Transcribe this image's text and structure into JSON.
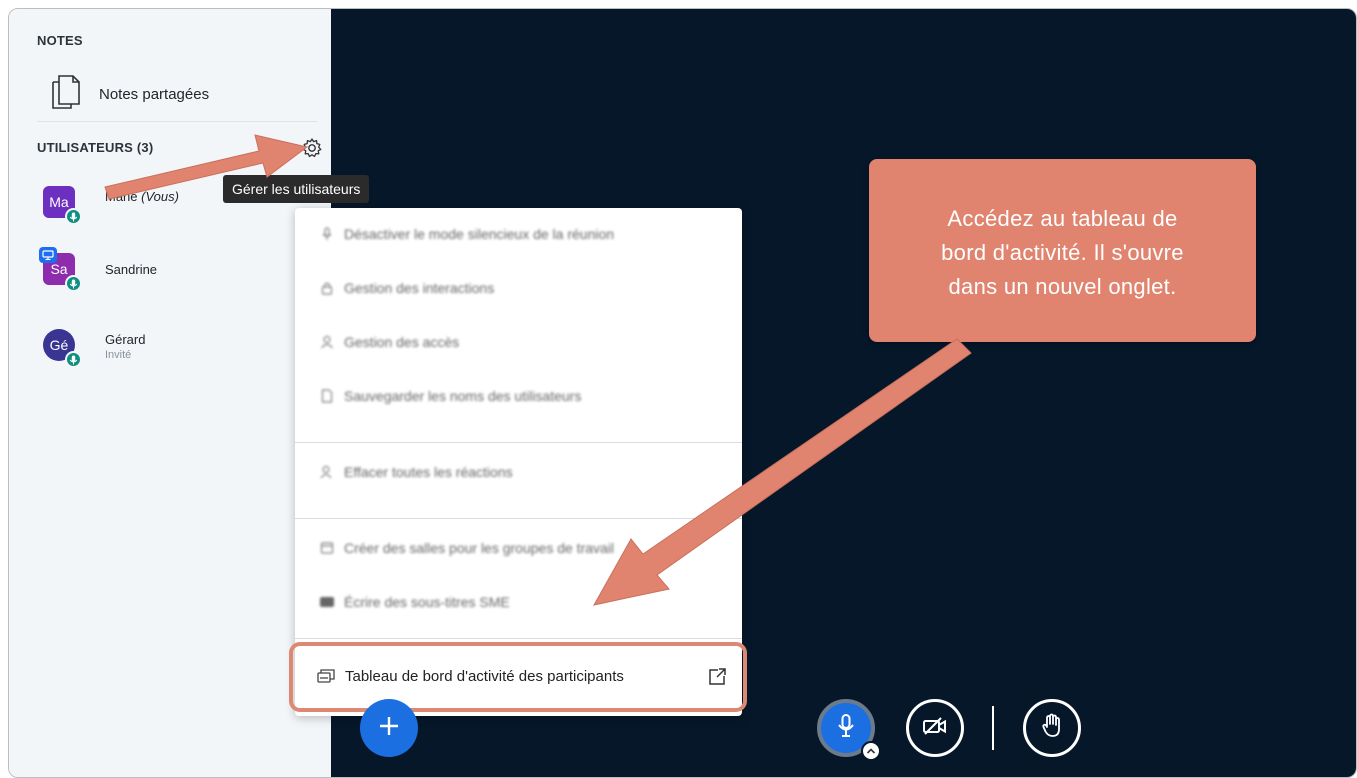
{
  "sidebar": {
    "notes_title": "NOTES",
    "notes_item_label": "Notes partagées",
    "users_title": "UTILISATEURS (3)",
    "users": [
      {
        "initials": "Ma",
        "name": "Marie",
        "suffix": "(Vous)",
        "role": "",
        "color": "#6c2fbf",
        "shape": "square"
      },
      {
        "initials": "Sa",
        "name": "Sandrine",
        "suffix": "",
        "role": "",
        "color": "#8e2cae",
        "shape": "square"
      },
      {
        "initials": "Gé",
        "name": "Gérard",
        "suffix": "",
        "role": "Invité",
        "color": "#3a3592",
        "shape": "round"
      }
    ]
  },
  "tooltip": "Gérer les utilisateurs",
  "menu": {
    "items": [
      {
        "label": "Désactiver le mode silencieux de la réunion",
        "icon": "mic-icon"
      },
      {
        "label": "Gestion des interactions",
        "icon": "lock-icon"
      },
      {
        "label": "Gestion des accès",
        "icon": "user-icon"
      },
      {
        "label": "Sauvegarder les noms des utilisateurs",
        "icon": "document-icon"
      },
      {
        "label": "Effacer toutes les réactions",
        "icon": "clear-reactions-icon"
      },
      {
        "label": "Créer des salles pour les groupes de travail",
        "icon": "rooms-icon"
      },
      {
        "label": "Écrire des sous-titres SME",
        "icon": "closed-captions-icon"
      }
    ],
    "final_item": "Tableau de bord d'activité des participants"
  },
  "callout": {
    "lines": [
      "Accédez au tableau de",
      "bord d'activité. Il s'ouvre",
      "dans un nouvel onglet."
    ]
  },
  "colors": {
    "accent": "#1b6fe0",
    "annotation": "#e0846f",
    "meeting_background": "#06172a",
    "mic_badge": "#0f8e82"
  }
}
